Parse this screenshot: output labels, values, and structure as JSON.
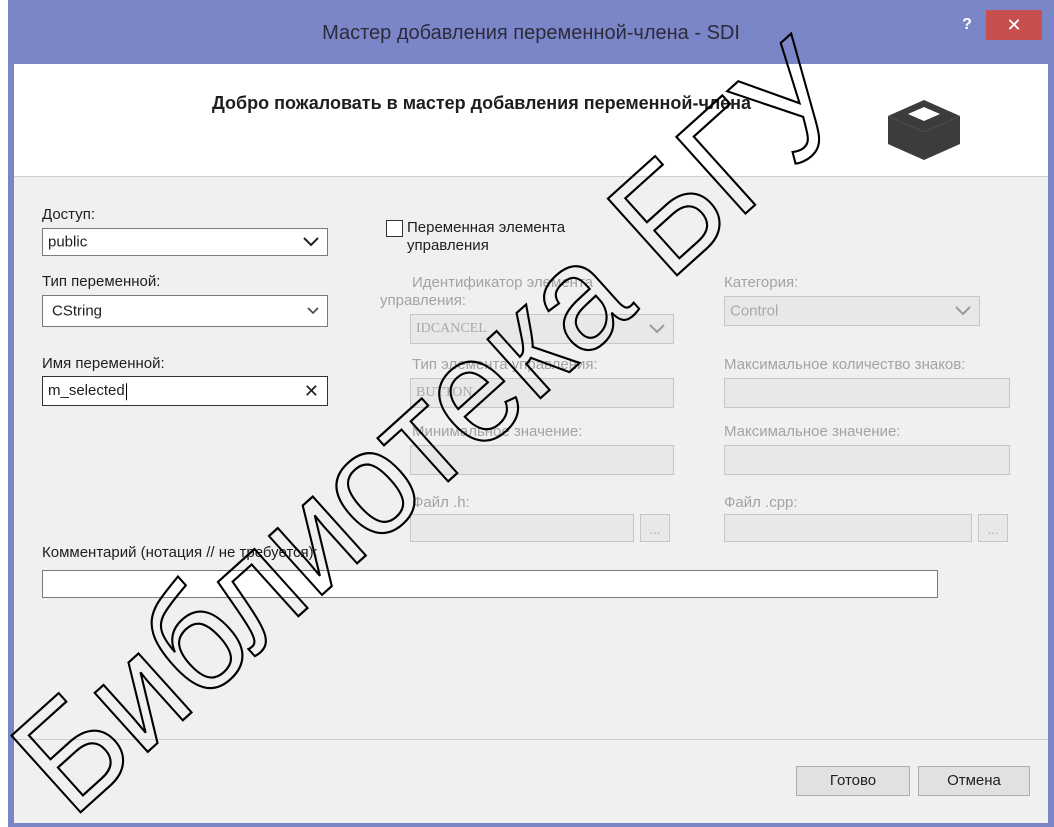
{
  "window": {
    "title": "Мастер добавления переменной-члена - SDI",
    "help_label": "?",
    "close_label": "✕"
  },
  "header": {
    "title": "Добро пожаловать в мастер добавления переменной-члена",
    "icon": "class-member-icon"
  },
  "access": {
    "label": "Доступ:",
    "value": "public"
  },
  "var_type": {
    "label": "Тип переменной:",
    "value": "CString"
  },
  "var_name": {
    "label": "Имя переменной:",
    "value": "m_selected"
  },
  "control_variable": {
    "label": "Переменная элемента управления",
    "checked": false
  },
  "control_id": {
    "label": "Идентификатор элемента управления:",
    "value": "IDCANCEL"
  },
  "category": {
    "label": "Категория:",
    "value": "Control"
  },
  "control_type": {
    "label": "Тип элемента управления:",
    "value": "BUTTON"
  },
  "max_chars": {
    "label": "Максимальное количество знаков:",
    "value": ""
  },
  "min_value": {
    "label": "Минимальное значение:",
    "value": ""
  },
  "max_value": {
    "label": "Максимальное значение:",
    "value": ""
  },
  "h_file": {
    "label": "Файл .h:",
    "value": "",
    "browse_label": "..."
  },
  "cpp_file": {
    "label": "Файл .cpp:",
    "value": "",
    "browse_label": "..."
  },
  "comment": {
    "label": "Комментарий (нотация // не требуется):",
    "value": ""
  },
  "buttons": {
    "finish": "Готово",
    "cancel": "Отмена"
  },
  "watermark": {
    "text": "Библиотека БГУ",
    "color": "#000000"
  }
}
